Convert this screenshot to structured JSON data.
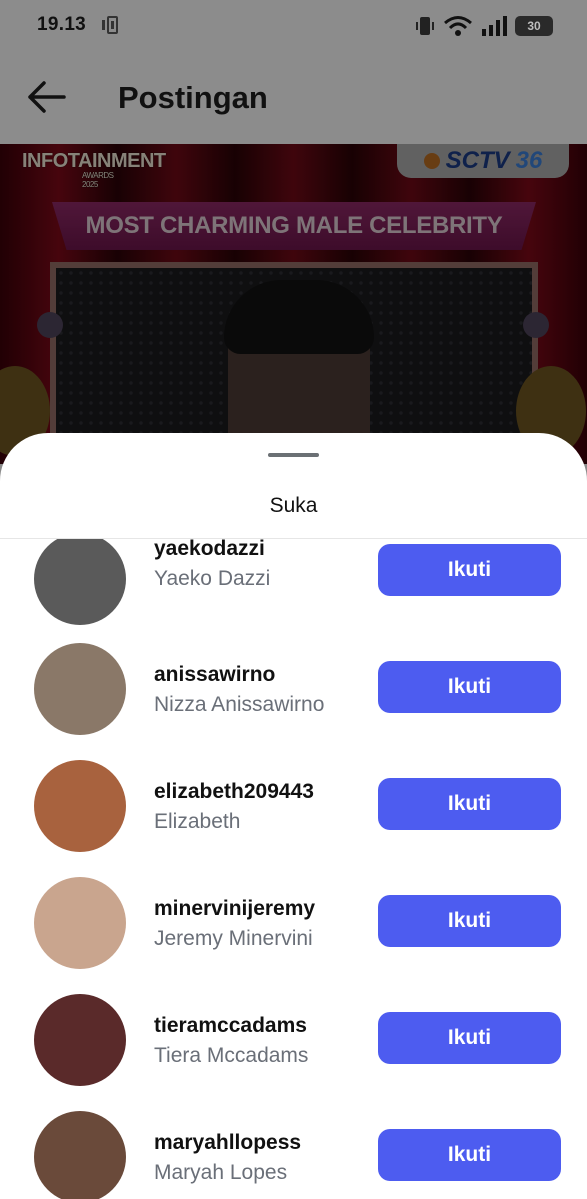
{
  "status_bar": {
    "time": "19.13",
    "battery": "30",
    "icons": [
      "media-icon",
      "vibrate-icon",
      "wifi-icon",
      "signal-icon",
      "battery-icon"
    ]
  },
  "header": {
    "title": "Postingan",
    "back_icon": "arrow-left-icon"
  },
  "post": {
    "logo_text": "INFOTAINMENT",
    "logo_sub": "AWARDS 2025",
    "channel_logo": "SCTV",
    "channel_badge": "36",
    "banner_text": "MOST CHARMING MALE CELEBRITY"
  },
  "sheet": {
    "title": "Suka",
    "likes": [
      {
        "handle": "yaekodazzi",
        "name": "Yaeko Dazzi",
        "button": "Ikuti",
        "avatar_color": "#5a5a5a"
      },
      {
        "handle": "anissawirno",
        "name": "Nizza Anissawirno",
        "button": "Ikuti",
        "avatar_color": "#8a7868"
      },
      {
        "handle": "elizabeth209443",
        "name": "Elizabeth",
        "button": "Ikuti",
        "avatar_color": "#a8623e"
      },
      {
        "handle": "minervinijeremy",
        "name": "Jeremy Minervini",
        "button": "Ikuti",
        "avatar_color": "#c9a58e"
      },
      {
        "handle": "tieramccadams",
        "name": "Tiera Mccadams",
        "button": "Ikuti",
        "avatar_color": "#5a2a2a"
      },
      {
        "handle": "maryahllopess",
        "name": "Maryah Lopes",
        "button": "Ikuti",
        "avatar_color": "#6a4a3a"
      }
    ]
  },
  "colors": {
    "follow_button": "#4d5cf0",
    "secondary_text": "#6a6f78"
  }
}
